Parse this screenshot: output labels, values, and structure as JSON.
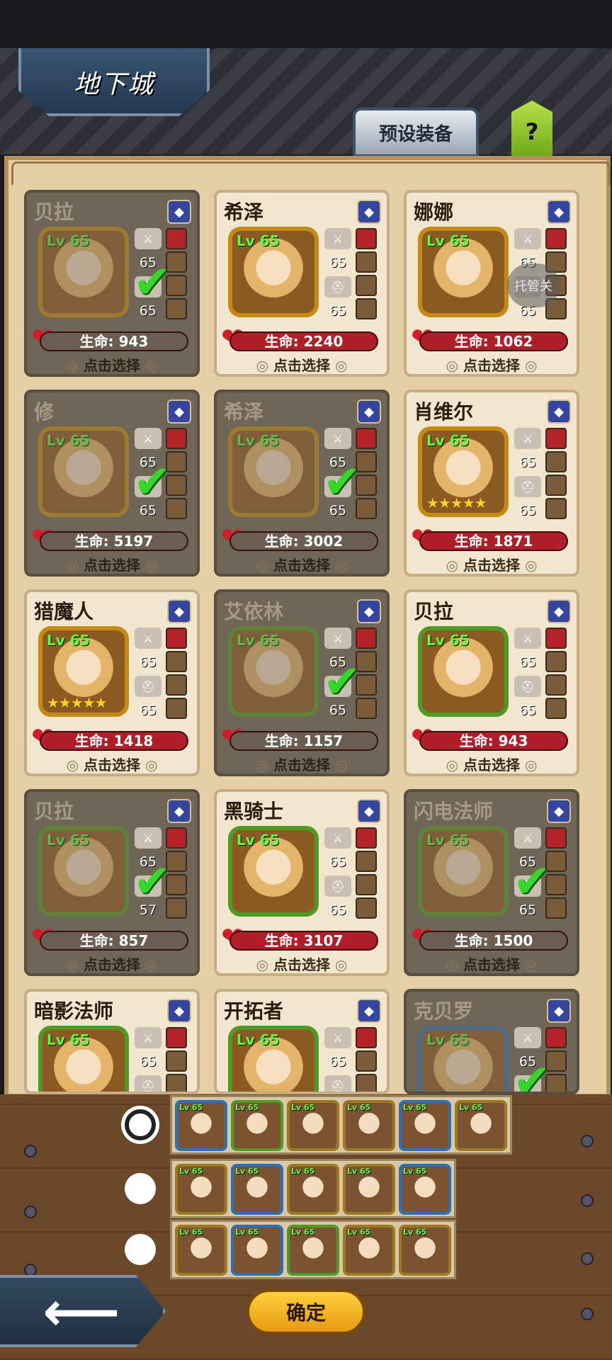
{
  "header": {
    "title": "地下城",
    "preset_label": "预设装备",
    "help_label": "?"
  },
  "auto_label": "托管关",
  "pick_label": "点击选择",
  "hp_prefix": "生命: ",
  "cards": [
    {
      "name": "贝拉",
      "lv": "Lv 65",
      "atk": "65",
      "def": "65",
      "hp": "943",
      "selected": true,
      "frame": "gold",
      "stars": ""
    },
    {
      "name": "希泽",
      "lv": "Lv 65",
      "atk": "65",
      "def": "65",
      "hp": "2240",
      "selected": false,
      "frame": "gold",
      "stars": ""
    },
    {
      "name": "娜娜",
      "lv": "Lv 65",
      "atk": "65",
      "def": "65",
      "hp": "1062",
      "selected": false,
      "frame": "gold",
      "stars": ""
    },
    {
      "name": "修",
      "lv": "Lv 65",
      "atk": "65",
      "def": "65",
      "hp": "5197",
      "selected": true,
      "frame": "gold",
      "stars": ""
    },
    {
      "name": "希泽",
      "lv": "Lv 65",
      "atk": "65",
      "def": "65",
      "hp": "3002",
      "selected": true,
      "frame": "gold",
      "stars": ""
    },
    {
      "name": "肖维尔",
      "lv": "Lv 65",
      "atk": "65",
      "def": "65",
      "hp": "1871",
      "selected": false,
      "frame": "gold",
      "stars": "★★★★★"
    },
    {
      "name": "猎魔人",
      "lv": "Lv 65",
      "atk": "65",
      "def": "65",
      "hp": "1418",
      "selected": false,
      "frame": "gold",
      "stars": "★★★★★"
    },
    {
      "name": "艾依林",
      "lv": "Lv 65",
      "atk": "65",
      "def": "65",
      "hp": "1157",
      "selected": true,
      "frame": "green",
      "stars": ""
    },
    {
      "name": "贝拉",
      "lv": "Lv 65",
      "atk": "65",
      "def": "65",
      "hp": "943",
      "selected": false,
      "frame": "green",
      "stars": ""
    },
    {
      "name": "贝拉",
      "lv": "Lv 65",
      "atk": "65",
      "def": "57",
      "hp": "857",
      "selected": true,
      "frame": "green",
      "stars": ""
    },
    {
      "name": "黑骑士",
      "lv": "Lv 65",
      "atk": "65",
      "def": "65",
      "hp": "3107",
      "selected": false,
      "frame": "green",
      "stars": ""
    },
    {
      "name": "闪电法师",
      "lv": "Lv 65",
      "atk": "65",
      "def": "65",
      "hp": "1500",
      "selected": true,
      "frame": "green",
      "stars": ""
    },
    {
      "name": "暗影法师",
      "lv": "Lv 65",
      "atk": "65",
      "def": "",
      "hp": "",
      "selected": false,
      "frame": "green",
      "stars": ""
    },
    {
      "name": "开拓者",
      "lv": "Lv 65",
      "atk": "65",
      "def": "",
      "hp": "",
      "selected": false,
      "frame": "green",
      "stars": ""
    },
    {
      "name": "克贝罗",
      "lv": "Lv 65",
      "atk": "65",
      "def": "",
      "hp": "",
      "selected": true,
      "frame": "blue",
      "stars": ""
    }
  ],
  "teams": [
    {
      "selected": true,
      "members": 6
    },
    {
      "selected": false,
      "members": 5
    },
    {
      "selected": false,
      "members": 5
    }
  ],
  "mini_lv": "Lv 65",
  "footer": {
    "back_symbol": "⟵",
    "confirm_label": "确定"
  }
}
